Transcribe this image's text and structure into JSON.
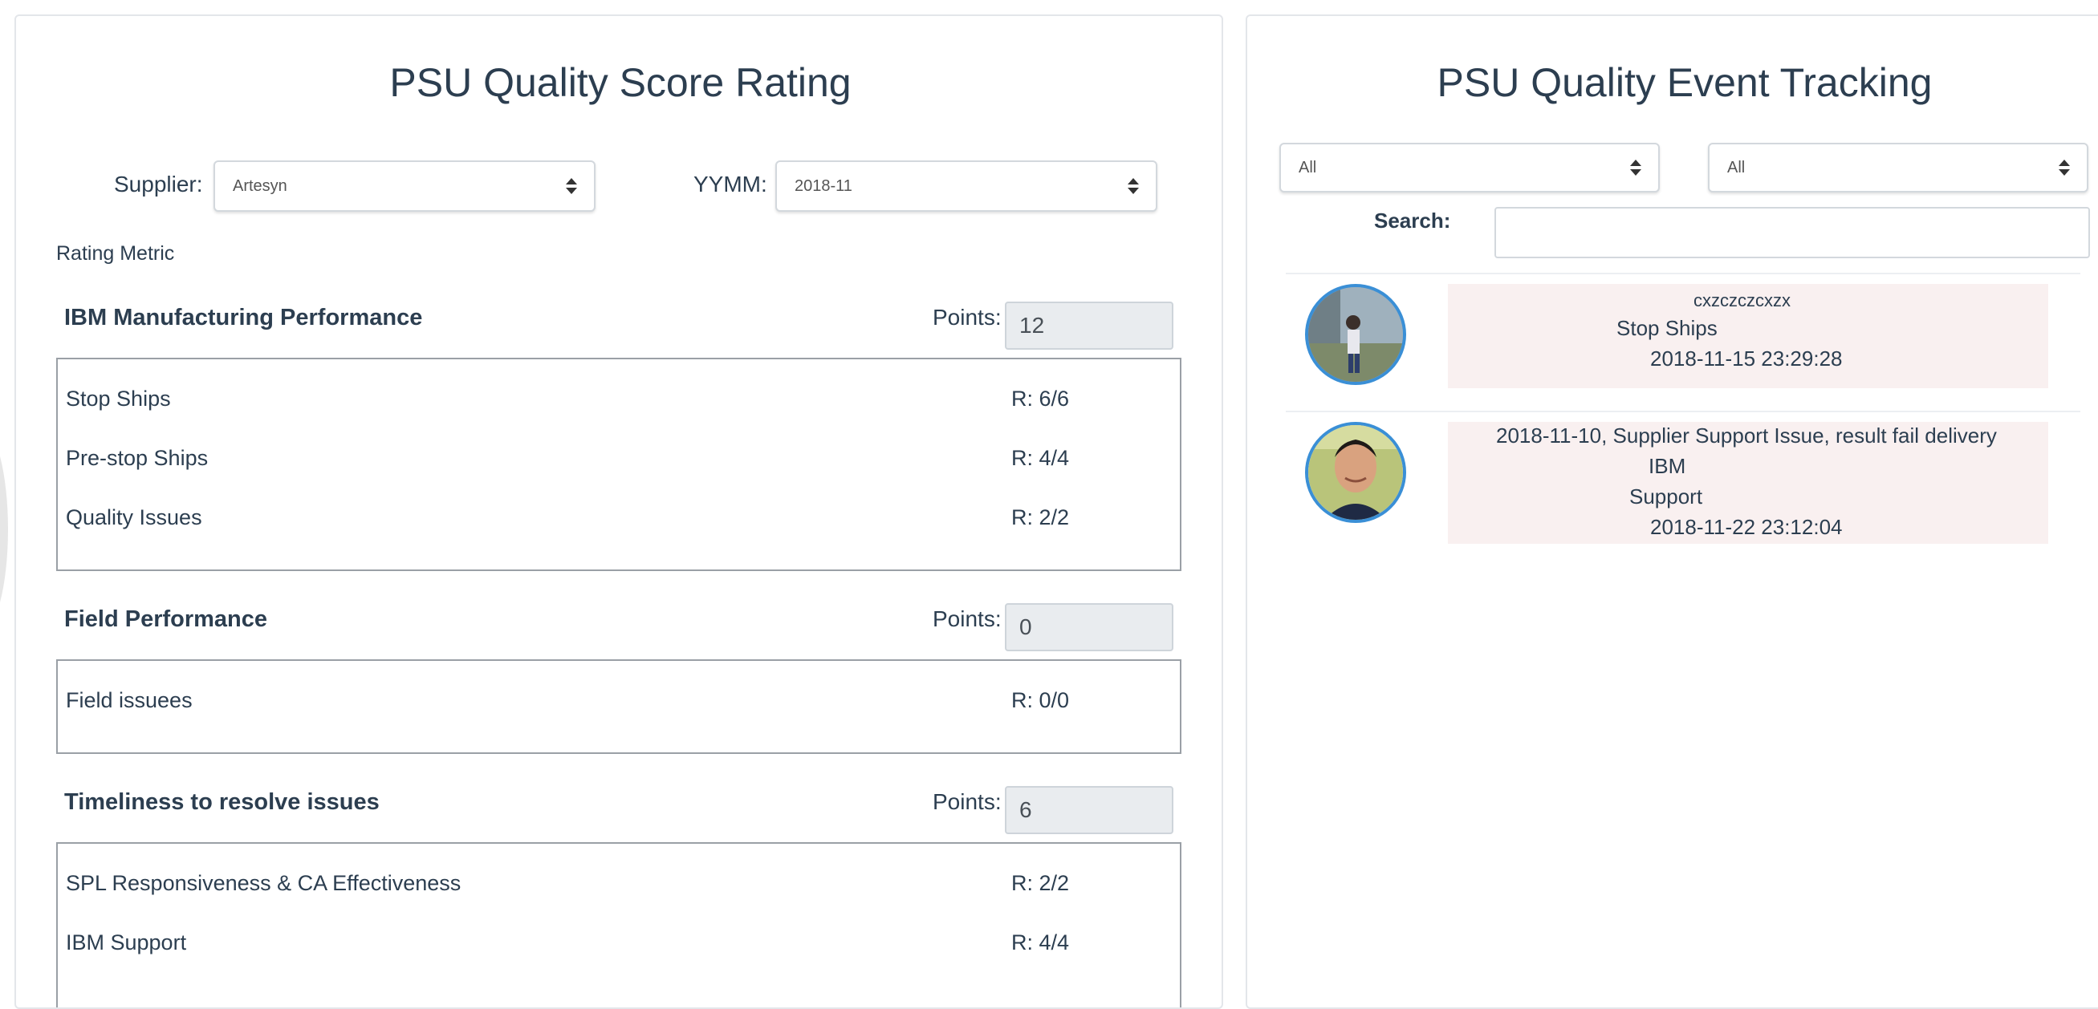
{
  "left": {
    "title": "PSU Quality Score Rating",
    "supplier_label": "Supplier:",
    "supplier_value": "Artesyn",
    "yymm_label": "YYMM:",
    "yymm_value": "2018-11",
    "rating_metric_label": "Rating Metric",
    "points_label": "Points:",
    "sections": [
      {
        "title": "IBM Manufacturing Performance",
        "points": "12",
        "metrics": [
          {
            "name": "Stop Ships",
            "value": "R: 6/6"
          },
          {
            "name": "Pre-stop Ships",
            "value": "R: 4/4"
          },
          {
            "name": "Quality Issues",
            "value": "R: 2/2"
          }
        ]
      },
      {
        "title": "Field Performance",
        "points": "0",
        "metrics": [
          {
            "name": "Field issuees",
            "value": "R: 0/0"
          }
        ]
      },
      {
        "title": "Timeliness to resolve issues",
        "points": "6",
        "metrics": [
          {
            "name": "SPL Responsiveness & CA Effectiveness",
            "value": "R: 2/2"
          },
          {
            "name": "IBM Support",
            "value": "R: 4/4"
          }
        ]
      }
    ]
  },
  "right": {
    "title": "PSU Quality Event Tracking",
    "filter1_value": "All",
    "filter2_value": "All",
    "search_label": "Search:",
    "search_value": "",
    "events": [
      {
        "lines": [
          "cxzczczcxzx",
          "Stop Ships",
          "2018-11-15 23:29:28"
        ]
      },
      {
        "lines": [
          "2018-11-10, Supplier Support Issue, result fail delivery",
          "IBM",
          "Support",
          "2018-11-22 23:12:04"
        ]
      }
    ]
  },
  "colors": {
    "text": "#2c3e50",
    "avatar_border": "#3a8fd6",
    "bubble_bg": "#f9f0f0",
    "points_bg": "#e9ecef"
  }
}
